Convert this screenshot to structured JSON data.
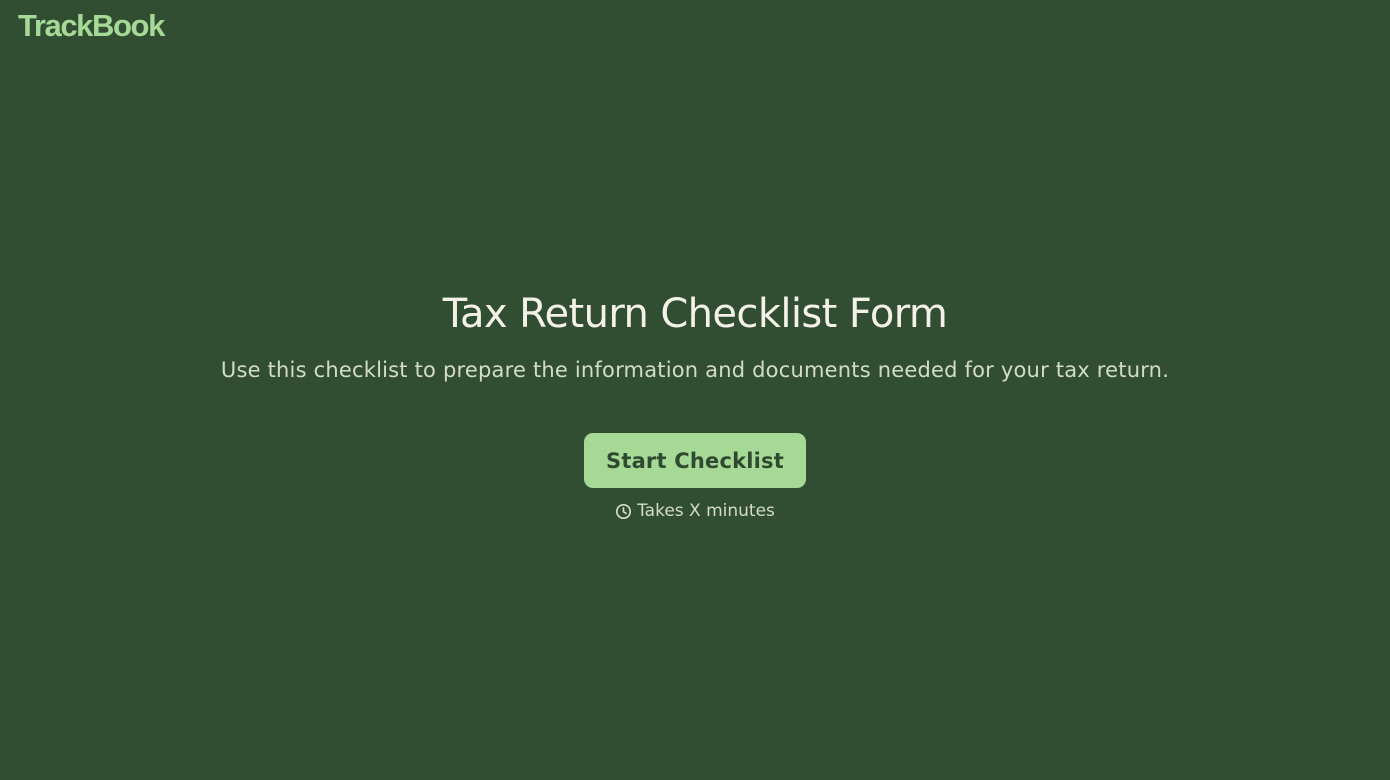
{
  "brand": {
    "logo_text": "TrackBook"
  },
  "hero": {
    "title": "Tax Return Checklist Form",
    "subtitle": "Use this checklist to prepare the information and documents needed for your tax return.",
    "start_label": "Start Checklist",
    "duration_text": "Takes X minutes",
    "duration_icon": "clock-icon"
  },
  "colors": {
    "background": "#314e33",
    "accent": "#a7d996",
    "title_text": "#f4f1e8",
    "body_text": "#d3dcc9",
    "button_text": "#2f4a30"
  }
}
